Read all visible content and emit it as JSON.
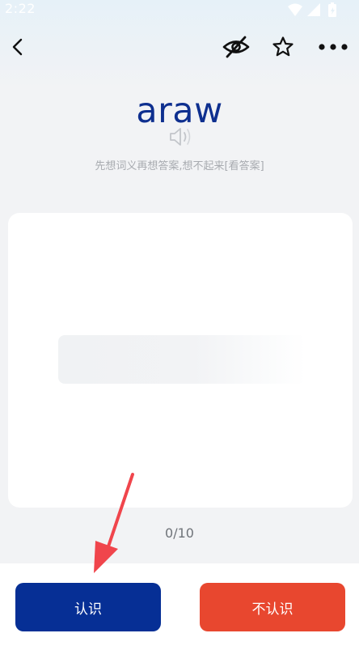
{
  "status_bar": {
    "time": "2:22",
    "icons": [
      "wifi-icon",
      "cellular-signal-icon",
      "battery-icon"
    ]
  },
  "app_bar": {
    "icons": [
      "back-icon",
      "eye-off-icon",
      "star-icon",
      "more-icon"
    ]
  },
  "word": {
    "text": "araw",
    "hint": "先想词义再想答案,想不起来[看答案]"
  },
  "progress": {
    "text": "0/10"
  },
  "actions": {
    "know_label": "认识",
    "unknown_label": "不认识"
  },
  "colors": {
    "word": "#0e2f8f",
    "know_button": "#062f95",
    "unknown_button": "#e8472f",
    "annotation_arrow": "#f0454c"
  }
}
